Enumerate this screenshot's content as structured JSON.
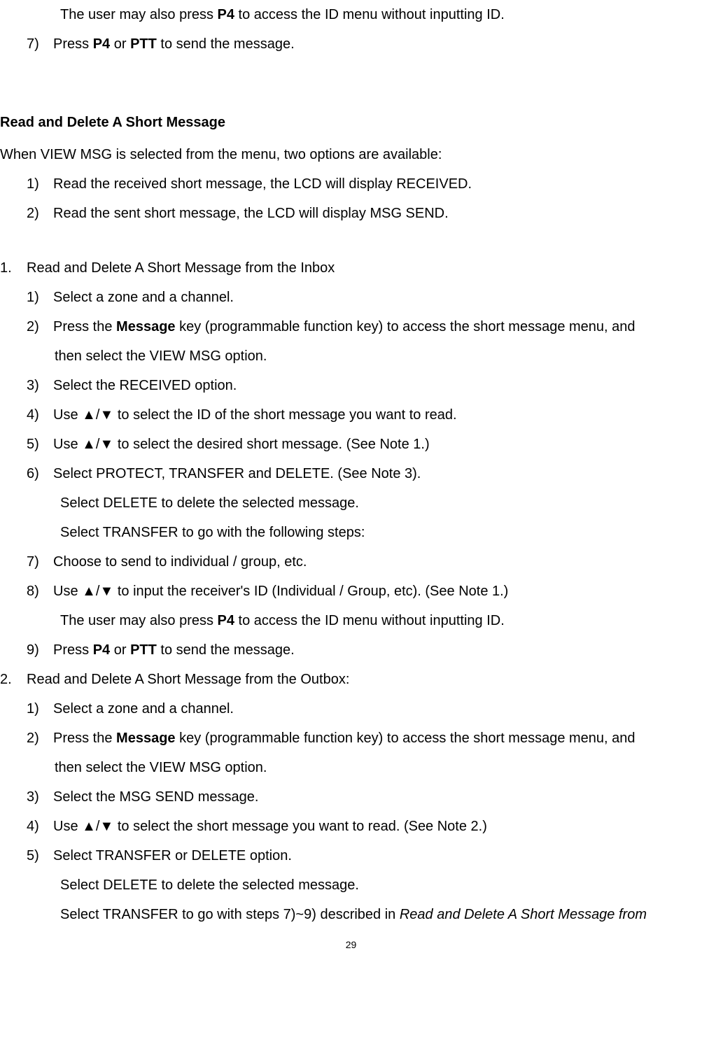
{
  "top": {
    "line1_pre": "The user may also press ",
    "line1_b": "P4",
    "line1_post": " to access the ID menu without inputting ID.",
    "item7_num": "7)",
    "item7_pre": "Press ",
    "item7_b1": "P4",
    "item7_mid": " or ",
    "item7_b2": "PTT",
    "item7_post": " to send the message."
  },
  "heading1": "Read and Delete A Short Message",
  "intro": "When VIEW MSG is selected from the menu, two options are available:",
  "intro_list": {
    "i1_num": "1)",
    "i1_text": "Read the received short message, the LCD will display RECEIVED.",
    "i2_num": "2)",
    "i2_text": "Read the sent short message, the LCD will display MSG SEND."
  },
  "sec1": {
    "num": "1.",
    "title": "Read and Delete A Short Message from the Inbox",
    "s1_num": "1)",
    "s1_text": "Select a zone and a channel.",
    "s2_num": "2)",
    "s2_pre": "Press the ",
    "s2_b": "Message",
    "s2_post": " key (programmable function key) to access the short message menu, and",
    "s2_cont": "then select the VIEW MSG option.",
    "s3_num": "3)",
    "s3_text": "Select the RECEIVED option.",
    "s4_num": "4)",
    "s4_text": "Use ▲/▼ to select the ID of the short message you want to read.",
    "s5_num": "5)",
    "s5_text": "Use ▲/▼ to select the desired short message. (See Note 1.)",
    "s6_num": "6)",
    "s6_text": "Select PROTECT, TRANSFER and DELETE. (See Note 3).",
    "s6_sub1": "Select DELETE to delete the selected message.",
    "s6_sub2": "Select TRANSFER to go with the following steps:",
    "s7_num": "7)",
    "s7_text": "Choose to send to individual / group, etc.",
    "s8_num": "8)",
    "s8_text": "Use ▲/▼ to input the receiver's ID (Individual / Group, etc). (See Note 1.)",
    "s8_sub_pre": "The user may also press ",
    "s8_sub_b": "P4",
    "s8_sub_post": " to access the ID menu without inputting ID.",
    "s9_num": "9)",
    "s9_pre": "Press ",
    "s9_b1": "P4",
    "s9_mid": " or ",
    "s9_b2": "PTT",
    "s9_post": " to send the message."
  },
  "sec2": {
    "num": "2.",
    "title": "Read and Delete A Short Message from the Outbox:",
    "s1_num": "1)",
    "s1_text": "Select a zone and a channel.",
    "s2_num": "2)",
    "s2_pre": "Press the ",
    "s2_b": "Message",
    "s2_post": " key (programmable function key) to access the short message menu, and",
    "s2_cont": "then select the VIEW MSG option.",
    "s3_num": "3)",
    "s3_text": "Select the MSG SEND message.",
    "s4_num": "4)",
    "s4_text": "Use ▲/▼ to select the short message you want to read. (See Note 2.)",
    "s5_num": "5)",
    "s5_text": "Select TRANSFER or DELETE option.",
    "s5_sub1": "Select DELETE to delete the selected message.",
    "s5_sub2_pre": "Select TRANSFER to go with steps 7)~9) described in ",
    "s5_sub2_i": "Read and Delete A Short Message from"
  },
  "pagenum": "29"
}
